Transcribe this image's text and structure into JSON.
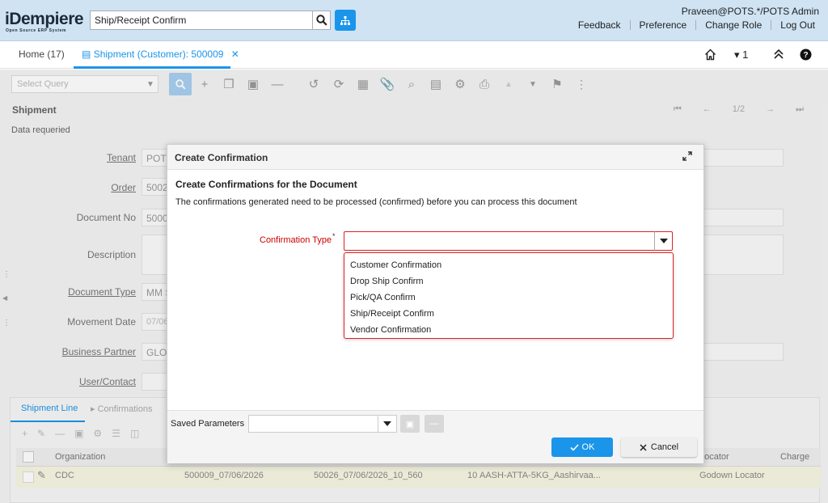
{
  "header": {
    "logo_main": "iDempiere",
    "logo_sub": "Open Source ERP System",
    "search_value": "Ship/Receipt Confirm",
    "user": "Praveen@POTS.*/POTS Admin",
    "links": [
      "Feedback",
      "Preference",
      "Change Role",
      "Log Out"
    ]
  },
  "tabs": {
    "home": "Home (17)",
    "active": "Shipment (Customer): 500009",
    "window_count": "1"
  },
  "window": {
    "select_query_placeholder": "Select Query",
    "section_title": "Shipment",
    "record_nav": "1/2",
    "data_required": "Data requeried",
    "fields": {
      "tenant_label": "Tenant",
      "tenant_value": "POTS",
      "order_label": "Order",
      "order_value": "5002",
      "docno_label": "Document No",
      "docno_value": "5000",
      "description_label": "Description",
      "doctype_label": "Document Type",
      "doctype_value": "MM S",
      "movement_label": "Movement Date",
      "movement_value": "07/06",
      "bp_label": "Business Partner",
      "bp_value": "GLOI",
      "user_label": "User/Contact"
    },
    "bottom_tabs": [
      "Shipment Line",
      "Confirmations"
    ],
    "grid_headers": [
      "Organization",
      "Locator",
      "Charge"
    ],
    "grid_row": {
      "org": "CDC",
      "shipment": "500009_07/06/2026",
      "order_line": "50026_07/06/2026_10_560",
      "line": "10",
      "product": "AASH-ATTA-5KG_Aashirvaa...",
      "locator": "Godown Locator"
    }
  },
  "dialog": {
    "title": "Create Confirmation",
    "heading": "Create Confirmations for the Document",
    "description": "The confirmations generated need to be processed (confirmed) before you can process this document",
    "confirmation_type_label": "Confirmation Type",
    "confirmation_type_value": "",
    "options": [
      "Customer Confirmation",
      "Drop Ship Confirm",
      "Pick/QA Confirm",
      "Ship/Receipt Confirm",
      "Vendor Confirmation"
    ],
    "saved_parameters_label": "Saved Parameters",
    "ok_label": "OK",
    "cancel_label": "Cancel"
  },
  "colors": {
    "accent": "#1a95ea",
    "header_bg": "#cfe3f3",
    "error": "#dd2222"
  }
}
